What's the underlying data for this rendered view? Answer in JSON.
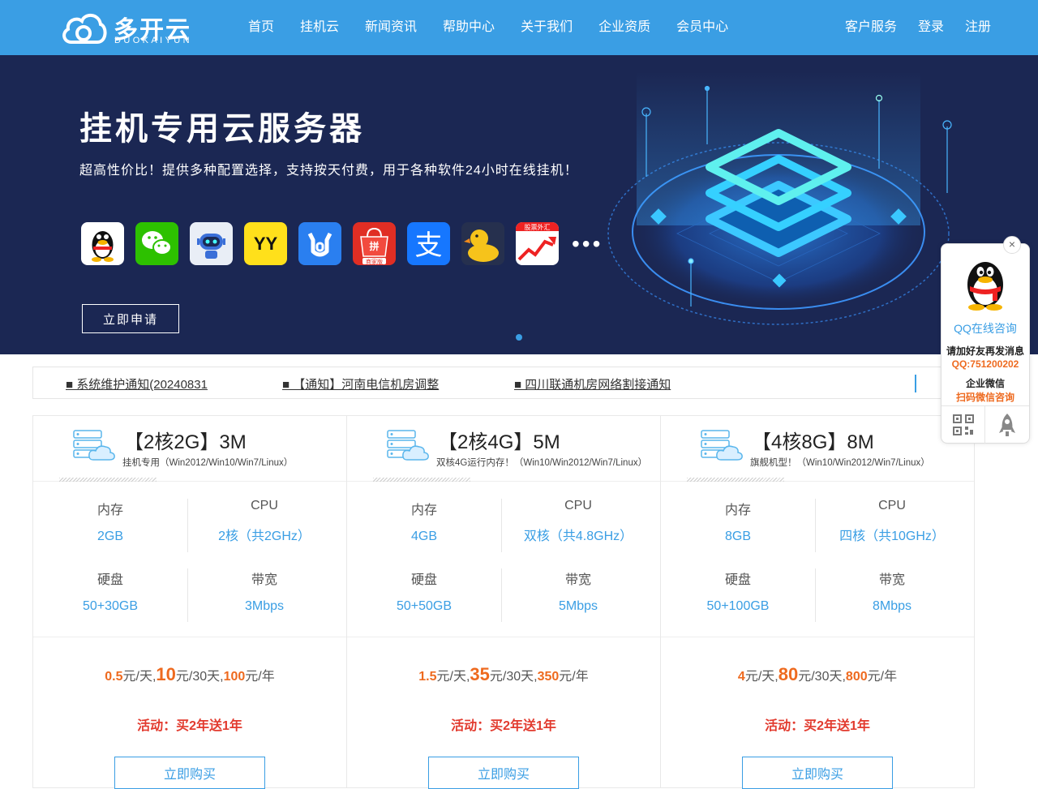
{
  "header": {
    "logo_cn": "多开云",
    "logo_en": "DUOKAIYUN",
    "nav": [
      "首页",
      "挂机云",
      "新闻资讯",
      "帮助中心",
      "关于我们",
      "企业资质",
      "会员中心"
    ],
    "right_links": [
      "客户服务",
      "登录",
      "注册"
    ]
  },
  "banner": {
    "title": "挂机专用云服务器",
    "subtitle": "超高性价比！提供多种配置选择，支持按天付费，用于各种软件24小时在线挂机！",
    "apps": [
      "qq-icon",
      "wechat-icon",
      "robot-icon",
      "yy-icon",
      "bull-icon",
      "pinduoduo-icon",
      "alipay-icon",
      "duck-icon",
      "stock-icon"
    ],
    "more": "•••",
    "app_labels": {
      "pdd": "商家版",
      "stock": "股票外汇"
    },
    "apply_label": "立即申请"
  },
  "notices": [
    "■ 系统维护通知(20240831",
    "■ 【通知】河南电信机房调整",
    "■ 四川联通机房网络割接通知"
  ],
  "labels": {
    "mem": "内存",
    "cpu": "CPU",
    "disk": "硬盘",
    "bw": "带宽"
  },
  "price_units": {
    "day": "元/天,",
    "month": "元/30天,",
    "year": "元/年"
  },
  "products": [
    {
      "title": "【2核2G】3M",
      "desc": "挂机专用（Win2012/Win10/Win7/Linux）",
      "mem": "2GB",
      "cpu": "2核（共2GHz）",
      "disk": "50+30GB",
      "bw": "3Mbps",
      "p_day": "0.5",
      "p_month": "10",
      "p_year": "100",
      "promo": "活动：买2年送1年",
      "buy": "立即购买"
    },
    {
      "title": "【2核4G】5M",
      "desc": "双核4G运行内存！（Win10/Win2012/Win7/Linux）",
      "mem": "4GB",
      "cpu": "双核（共4.8GHz）",
      "disk": "50+50GB",
      "bw": "5Mbps",
      "p_day": "1.5",
      "p_month": "35",
      "p_year": "350",
      "promo": "活动：买2年送1年",
      "buy": "立即购买"
    },
    {
      "title": "【4核8G】8M",
      "desc": "旗舰机型！（Win10/Win2012/Win7/Linux）",
      "mem": "8GB",
      "cpu": "四核（共10GHz）",
      "disk": "50+100GB",
      "bw": "8Mbps",
      "p_day": "4",
      "p_month": "80",
      "p_year": "800",
      "promo": "活动：买2年送1年",
      "buy": "立即购买"
    }
  ],
  "qq_panel": {
    "close": "×",
    "online": "QQ在线咨询",
    "add_friend": "请加好友再发消息",
    "qq_number": "QQ:751200202",
    "wechat_title": "企业微信",
    "wechat_scan": "扫码微信咨询"
  },
  "colors": {
    "accent": "#3a9ee4",
    "banner_bg": "#1b2753",
    "price": "#ee6a1f",
    "promo": "#e23a2e"
  }
}
